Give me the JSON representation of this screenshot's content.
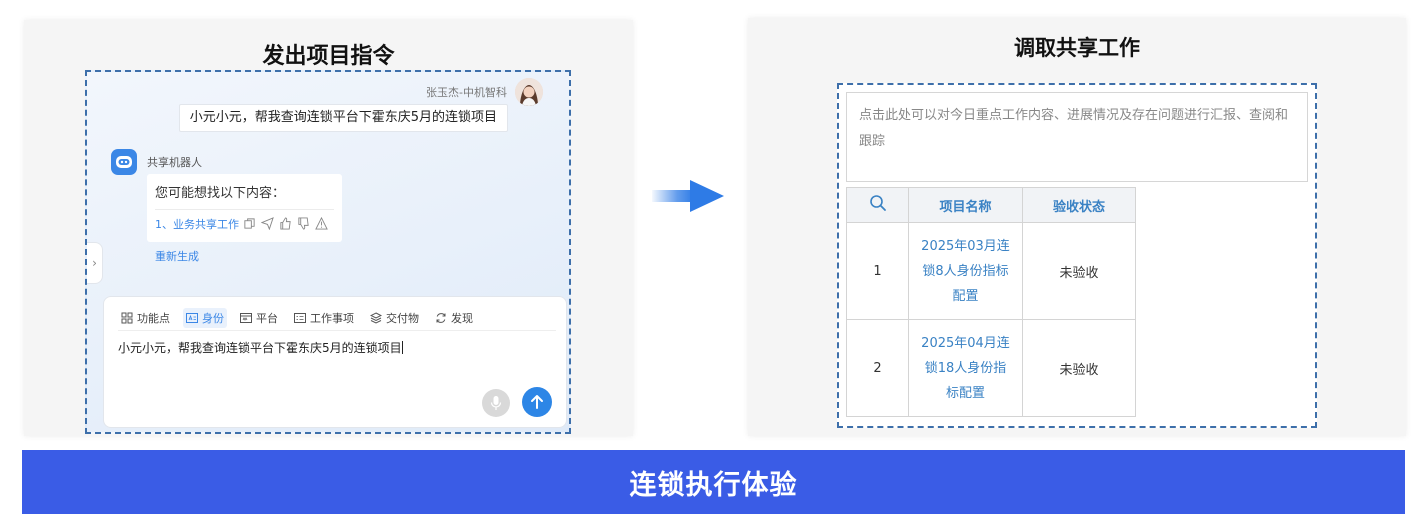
{
  "left_panel": {
    "title": "发出项目指令",
    "user_name": "张玉杰-中机智科",
    "user_message": "小元小元，帮我查询连锁平台下霍东庆5月的连锁项目",
    "bot_name": "共享机器人",
    "bot_lead": "您可能想找以下内容：",
    "bot_link": "1、业务共享工作",
    "regenerate": "重新生成",
    "toolbar": [
      {
        "label": "功能点",
        "icon": "grid-icon"
      },
      {
        "label": "身份",
        "icon": "id-card-icon"
      },
      {
        "label": "平台",
        "icon": "platform-icon"
      },
      {
        "label": "工作事项",
        "icon": "task-icon"
      },
      {
        "label": "交付物",
        "icon": "layers-icon"
      },
      {
        "label": "发现",
        "icon": "refresh-icon"
      }
    ],
    "input_value": "小元小元，帮我查询连锁平台下霍东庆5月的连锁项目"
  },
  "right_panel": {
    "title": "调取共享工作",
    "hint": "点击此处可以对今日重点工作内容、进展情况及存在问题进行汇报、查阅和跟踪",
    "table": {
      "headers": [
        "项目名称",
        "验收状态"
      ],
      "rows": [
        {
          "index": "1",
          "name": "2025年03月连锁8人身份指标配置",
          "status": "未验收"
        },
        {
          "index": "2",
          "name": "2025年04月连锁18人身份指标配置",
          "status": "未验收"
        }
      ]
    }
  },
  "banner": "连锁执行体验",
  "colors": {
    "accent": "#2d86e6",
    "banner": "#3a5ce6",
    "dashed_border": "#3d6faa",
    "link": "#3b87e6"
  }
}
